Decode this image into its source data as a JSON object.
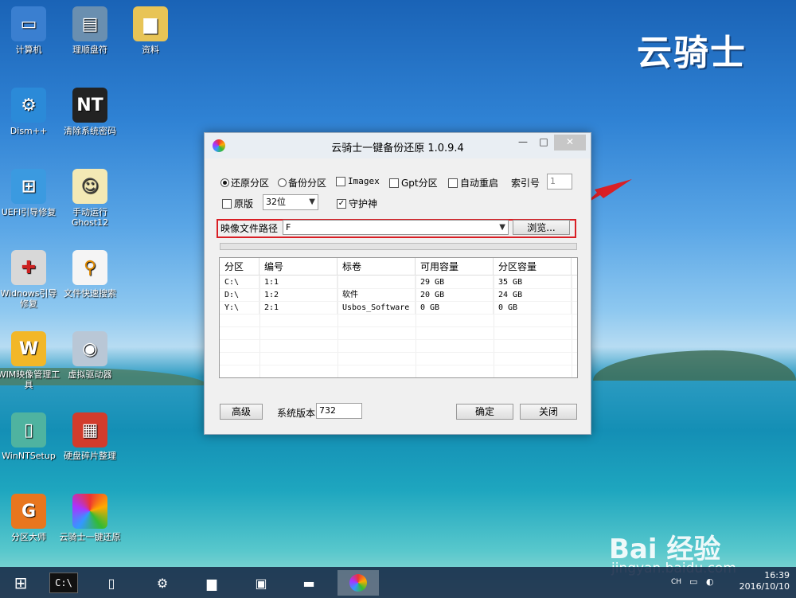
{
  "brand": "云骑士",
  "watermark": {
    "line1": "Bai 经验",
    "line2": "jingyan.baidu.com"
  },
  "desktop_icons": [
    {
      "label": "计算机"
    },
    {
      "label": "理顺盘符"
    },
    {
      "label": "资料"
    },
    {
      "label": "Dism++"
    },
    {
      "label": "清除系统密码"
    },
    {
      "label": "UEFI引导修复"
    },
    {
      "label": "手动运行Ghost12"
    },
    {
      "label": "Widnows引导修复"
    },
    {
      "label": "文件快速搜索"
    },
    {
      "label": "WIM映像管理工具"
    },
    {
      "label": "虚拟驱动器"
    },
    {
      "label": "WinNTSetup"
    },
    {
      "label": "硬盘碎片整理"
    },
    {
      "label": "分区大师"
    },
    {
      "label": "云骑士一键还原"
    }
  ],
  "window": {
    "title": "云骑士一键备份还原 1.0.9.4",
    "radio_restore": "还原分区",
    "radio_backup": "备份分区",
    "cb_imagex": "Imagex",
    "cb_gpt": "Gpt分区",
    "cb_autoreboot": "自动重启",
    "index_label": "索引号",
    "index_value": "1",
    "cb_original": "原版",
    "arch_value": "32位",
    "cb_guard": "守护神",
    "path_label": "映像文件路径",
    "path_value": "F",
    "browse_label": "浏览...",
    "columns": [
      "分区",
      "编号",
      "标卷",
      "可用容量",
      "分区容量"
    ],
    "rows": [
      [
        "C:\\",
        "1:1",
        "",
        "29 GB",
        "35 GB"
      ],
      [
        "D:\\",
        "1:2",
        "软件",
        "20 GB",
        "24 GB"
      ],
      [
        "Y:\\",
        "2:1",
        "Usbos_Software",
        "0 GB",
        "0 GB"
      ]
    ],
    "advanced_label": "高级",
    "sysver_label": "系统版本",
    "sysver_value": "732",
    "ok_label": "确定",
    "close_label": "关闭"
  },
  "taskbar": {
    "lang": "CH",
    "time": "16:39",
    "date": "2016/10/10"
  },
  "colors": {
    "highlight": "#d91f25",
    "accent": "#1a63b6"
  }
}
